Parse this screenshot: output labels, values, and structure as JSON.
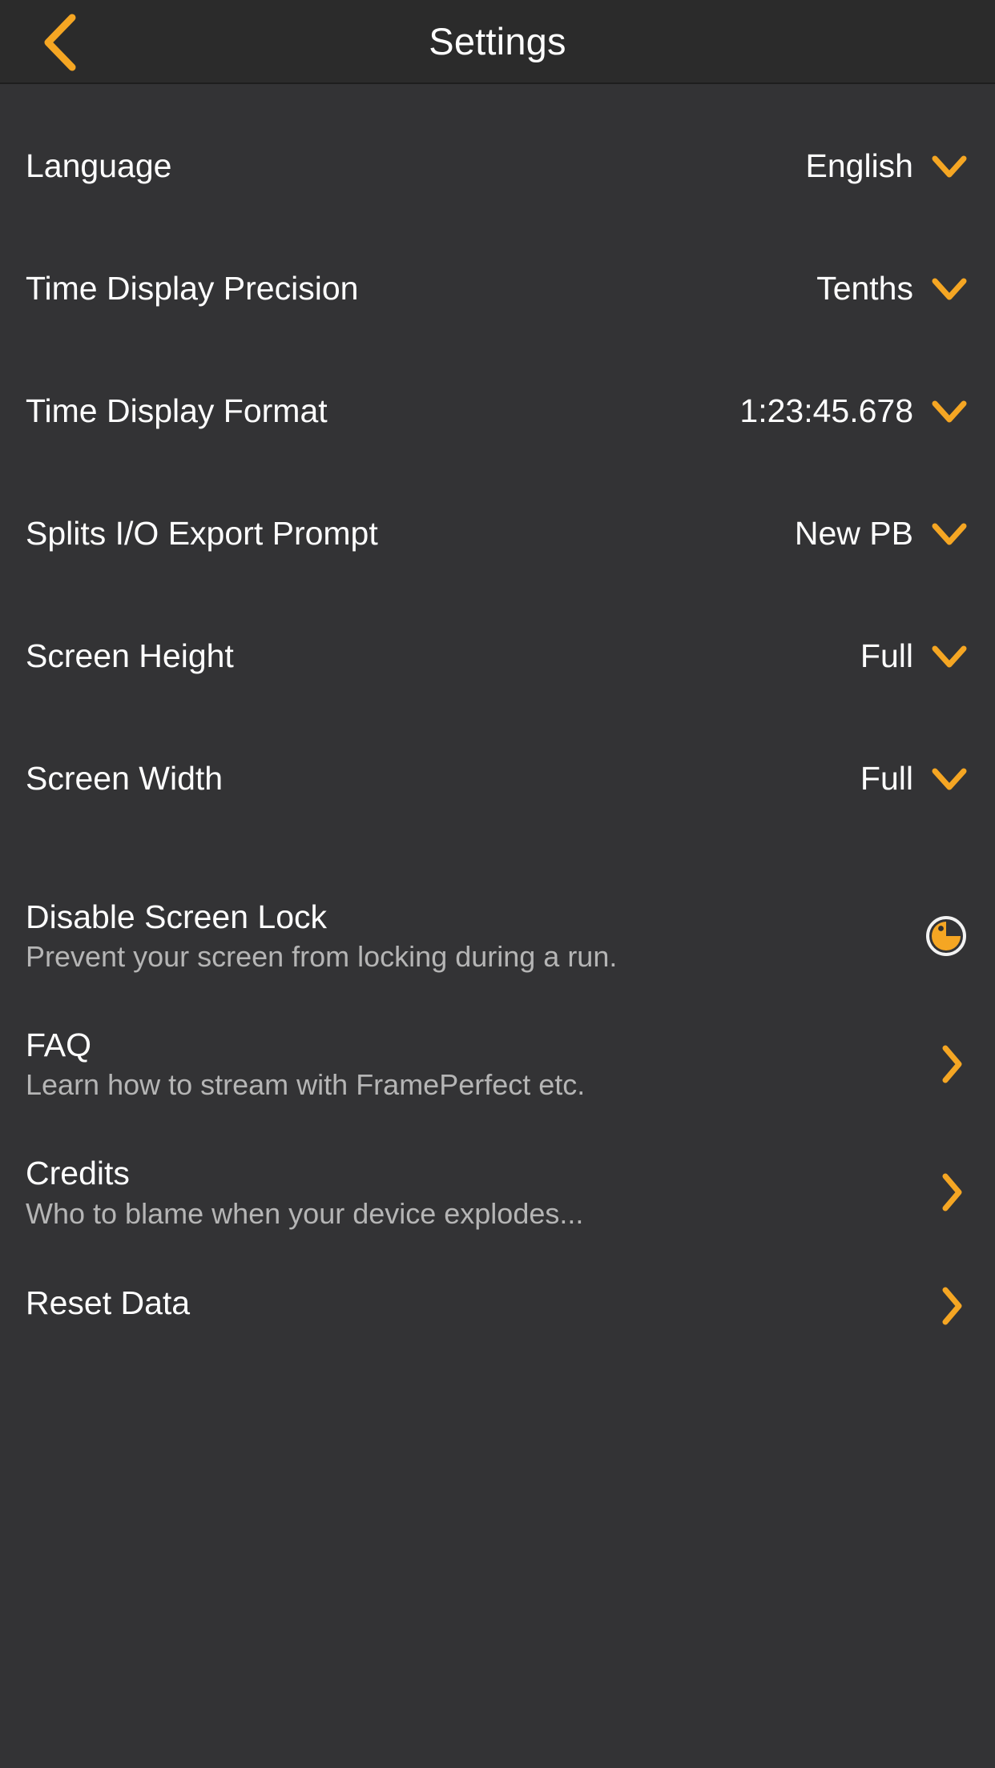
{
  "theme": {
    "accent": "#f5a623",
    "header_bg": "#2b2b2b",
    "body_bg": "#333335",
    "text": "#ffffff",
    "subtext": "#b5b5b5"
  },
  "header": {
    "title": "Settings",
    "back_icon": "chevron-left-icon"
  },
  "settings": {
    "select_rows": [
      {
        "label": "Language",
        "value": "English",
        "icon": "chevron-down-icon"
      },
      {
        "label": "Time Display Precision",
        "value": "Tenths",
        "icon": "chevron-down-icon"
      },
      {
        "label": "Time Display Format",
        "value": "1:23:45.678",
        "icon": "chevron-down-icon"
      },
      {
        "label": "Splits I/O Export Prompt",
        "value": "New PB",
        "icon": "chevron-down-icon"
      },
      {
        "label": "Screen Height",
        "value": "Full",
        "icon": "chevron-down-icon"
      },
      {
        "label": "Screen Width",
        "value": "Full",
        "icon": "chevron-down-icon"
      }
    ],
    "toggle_row": {
      "title": "Disable Screen Lock",
      "subtitle": "Prevent your screen from locking during a run.",
      "icon": "checked-circle-icon",
      "checked": true
    },
    "link_rows": [
      {
        "title": "FAQ",
        "subtitle": "Learn how to stream with FramePerfect etc.",
        "icon": "chevron-right-icon"
      },
      {
        "title": "Credits",
        "subtitle": "Who to blame when your device explodes...",
        "icon": "chevron-right-icon"
      },
      {
        "title": "Reset Data",
        "subtitle": "",
        "icon": "chevron-right-icon"
      }
    ]
  }
}
